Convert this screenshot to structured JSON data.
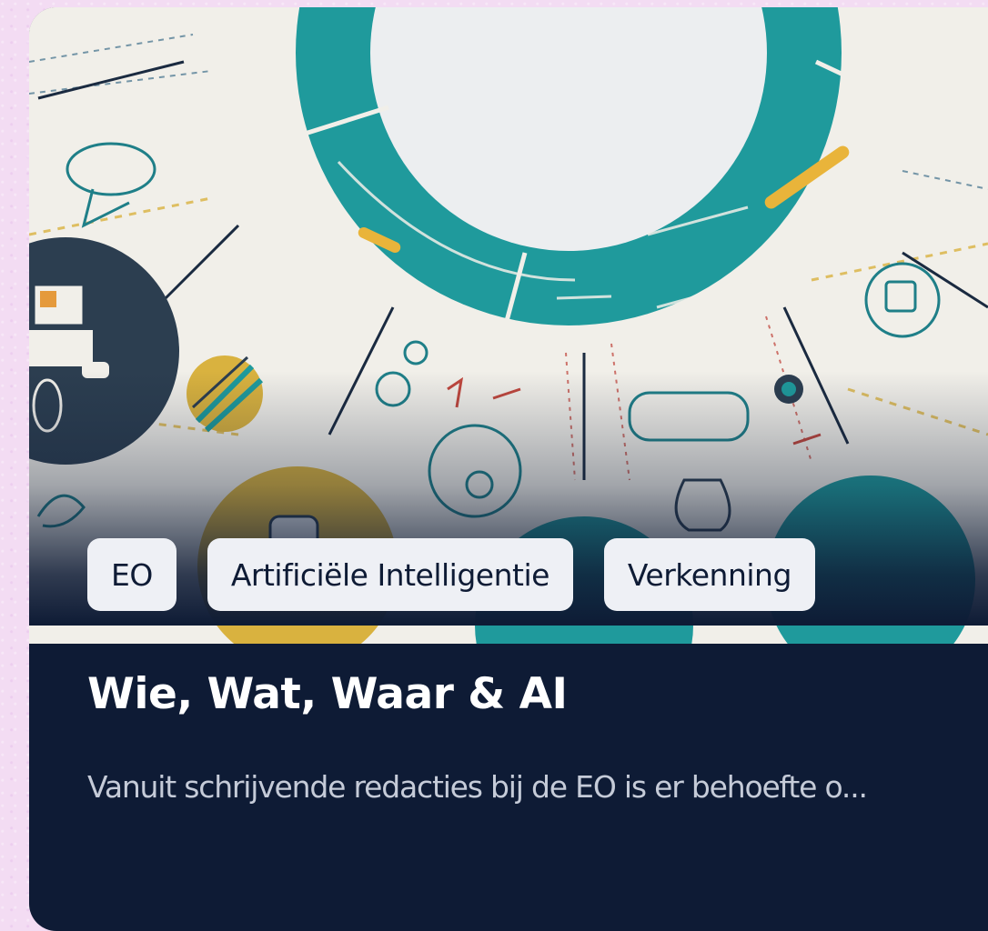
{
  "card": {
    "tags": [
      "EO",
      "Artificiële Intelligentie",
      "Verkenning"
    ],
    "title": "Wie, Wat, Waar & AI",
    "description": "Vanuit schrijvende redacties bij de EO is er behoefte o..."
  },
  "colors": {
    "page_background": "#f3dcf3",
    "card_background": "#0e1b35",
    "tag_background": "#eef0f5",
    "title_text": "#ffffff",
    "description_text": "#c5cbd8",
    "teal": "#1f9a9c",
    "mustard": "#d9b23f"
  }
}
